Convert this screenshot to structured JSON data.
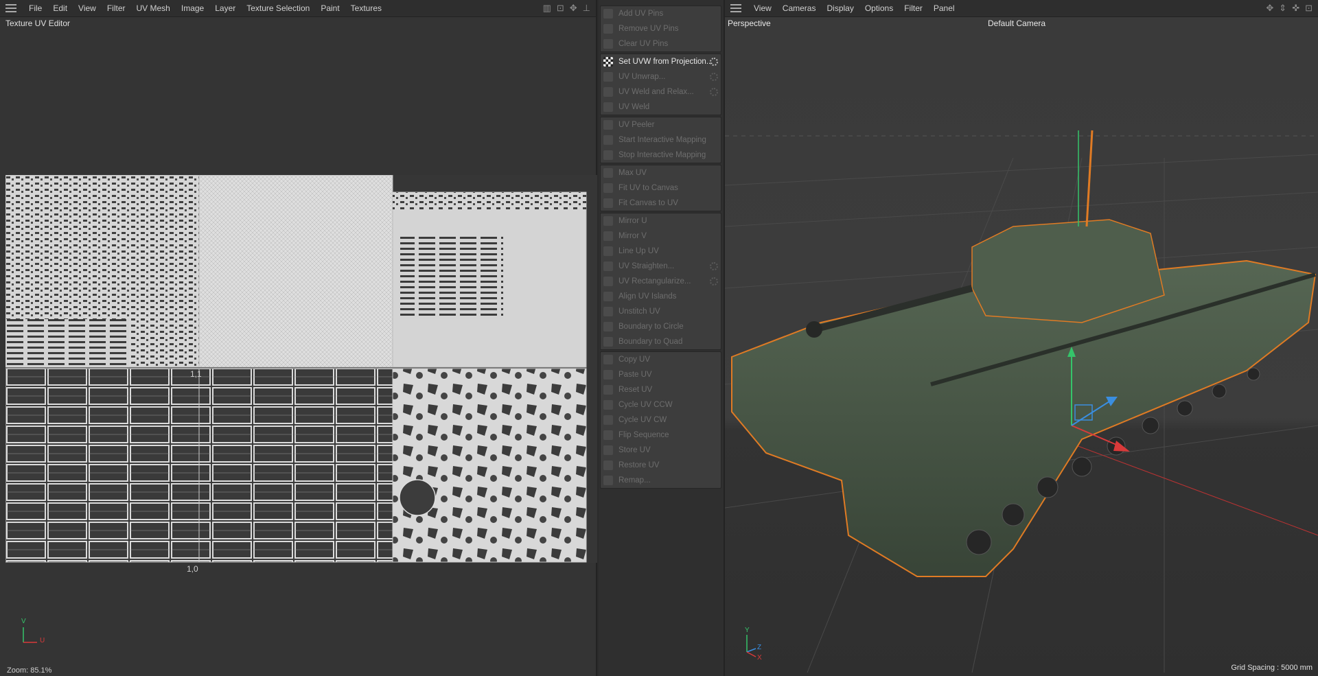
{
  "uv_editor": {
    "menu": [
      "File",
      "Edit",
      "View",
      "Filter",
      "UV Mesh",
      "Image",
      "Layer",
      "Texture Selection",
      "Paint",
      "Textures"
    ],
    "title": "Texture UV Editor",
    "coord_label_top": "1,1",
    "coord_label_bottom": "1,0",
    "axis_v": "V",
    "axis_u": "U",
    "zoom": "Zoom: 85.1%"
  },
  "commands": {
    "groups": [
      {
        "items": [
          {
            "label": "Add UV Pins",
            "active": false,
            "gear": false
          },
          {
            "label": "Remove UV Pins",
            "active": false,
            "gear": false
          },
          {
            "label": "Clear UV Pins",
            "active": false,
            "gear": false
          }
        ]
      },
      {
        "items": [
          {
            "label": "Set UVW from Projection...",
            "active": true,
            "gear": true
          },
          {
            "label": "UV Unwrap...",
            "active": false,
            "gear": true
          },
          {
            "label": "UV Weld and Relax...",
            "active": false,
            "gear": true
          },
          {
            "label": "UV Weld",
            "active": false,
            "gear": false
          }
        ]
      },
      {
        "items": [
          {
            "label": "UV Peeler",
            "active": false,
            "gear": false
          },
          {
            "label": "Start Interactive Mapping",
            "active": false,
            "gear": false
          },
          {
            "label": "Stop Interactive Mapping",
            "active": false,
            "gear": false
          }
        ]
      },
      {
        "items": [
          {
            "label": "Max UV",
            "active": false,
            "gear": false
          },
          {
            "label": "Fit UV to Canvas",
            "active": false,
            "gear": false
          },
          {
            "label": "Fit Canvas to UV",
            "active": false,
            "gear": false
          }
        ]
      },
      {
        "items": [
          {
            "label": "Mirror U",
            "active": false,
            "gear": false
          },
          {
            "label": "Mirror V",
            "active": false,
            "gear": false
          },
          {
            "label": "Line Up UV",
            "active": false,
            "gear": false
          },
          {
            "label": "UV Straighten...",
            "active": false,
            "gear": true
          },
          {
            "label": "UV Rectangularize...",
            "active": false,
            "gear": true
          },
          {
            "label": "Align UV Islands",
            "active": false,
            "gear": false
          },
          {
            "label": "Unstitch UV",
            "active": false,
            "gear": false
          },
          {
            "label": "Boundary to Circle",
            "active": false,
            "gear": false
          },
          {
            "label": "Boundary to Quad",
            "active": false,
            "gear": false
          }
        ]
      },
      {
        "items": [
          {
            "label": "Copy UV",
            "active": false,
            "gear": false
          },
          {
            "label": "Paste UV",
            "active": false,
            "gear": false
          },
          {
            "label": "Reset UV",
            "active": false,
            "gear": false
          },
          {
            "label": "Cycle UV CCW",
            "active": false,
            "gear": false
          },
          {
            "label": "Cycle UV CW",
            "active": false,
            "gear": false
          },
          {
            "label": "Flip Sequence",
            "active": false,
            "gear": false
          },
          {
            "label": "Store UV",
            "active": false,
            "gear": false
          },
          {
            "label": "Restore UV",
            "active": false,
            "gear": false
          },
          {
            "label": "Remap...",
            "active": false,
            "gear": false
          }
        ]
      }
    ]
  },
  "viewport": {
    "menu": [
      "View",
      "Cameras",
      "Display",
      "Options",
      "Filter",
      "Panel"
    ],
    "projection": "Perspective",
    "camera": "Default Camera",
    "axis_y": "Y",
    "axis_z": "Z",
    "axis_x": "X",
    "grid_spacing": "Grid Spacing : 5000 mm"
  },
  "colors": {
    "selection_outline": "#e07b24",
    "axis_y": "#35c46a",
    "axis_x": "#d93a3a",
    "axis_z": "#3a8ee0",
    "tank_body": "#445443"
  }
}
